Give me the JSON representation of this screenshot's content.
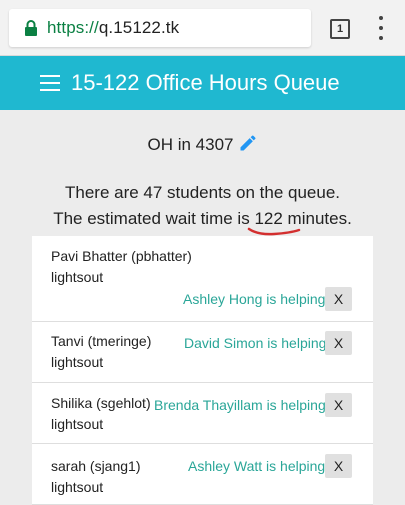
{
  "browser": {
    "url_scheme": "https://",
    "url_host": "q.15122.tk",
    "tab_count": "1",
    "icons": {
      "lock": "lock-icon",
      "menu": "overflow-menu-icon"
    },
    "secure_color": "#0b8043"
  },
  "header": {
    "title": "15-122 Office Hours Queue",
    "background_color": "#1fb8d0",
    "menu_icon": "hamburger-menu-icon"
  },
  "location": {
    "text": "OH in 4307",
    "edit_icon": "pencil-icon",
    "accent_color": "#2196f3"
  },
  "queue_info": {
    "students_line": "There are 47 students on the queue.",
    "wait_prefix": "The estimated wait time is",
    "wait_minutes": "122",
    "wait_suffix": "minutes."
  },
  "queue": [
    {
      "name": "Pavi Bhatter (pbhatter)",
      "topic": "lightsout",
      "helper": "Ashley Hong is helping",
      "remove_label": "X"
    },
    {
      "name": "Tanvi (tmeringe)",
      "topic": "lightsout",
      "helper": "David Simon is helping",
      "remove_label": "X"
    },
    {
      "name": "Shilika (sgehlot)",
      "topic": "lightsout",
      "helper": "Brenda Thayillam is helping",
      "remove_label": "X"
    },
    {
      "name": "sarah (sjang1)",
      "topic": "lightsout",
      "helper": "Ashley Watt is helping",
      "remove_label": "X"
    }
  ],
  "helper_color": "#2aa698"
}
